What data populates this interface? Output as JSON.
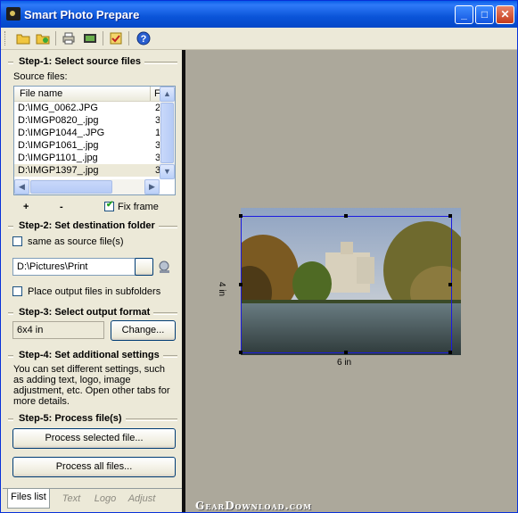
{
  "window": {
    "title": "Smart Photo Prepare",
    "minimize": "_",
    "maximize": "□",
    "close": "✕"
  },
  "toolbar": {
    "icons": [
      "open-folder-icon",
      "open-project-icon",
      "print-icon",
      "film-icon",
      "checklist-icon",
      "help-icon"
    ]
  },
  "steps": {
    "step1": "Step-1: Select source files",
    "source_label": "Source files:",
    "step2": "Step-2: Set destination folder",
    "step3": "Step-3: Select output format",
    "step4": "Step-4: Set additional settings",
    "step4_desc": "You can set different settings, such as adding text, logo, image adjustment, etc. Open other tabs for more details.",
    "step5": "Step-5: Process file(s)"
  },
  "filelist": {
    "headers": [
      "File name",
      "F"
    ],
    "rows": [
      {
        "name": "D:\\IMG_0062.JPG",
        "f": "2"
      },
      {
        "name": "D:\\IMGP0820_.jpg",
        "f": "3"
      },
      {
        "name": "D:\\IMGP1044_.JPG",
        "f": "1"
      },
      {
        "name": "D:\\IMGP1061_.jpg",
        "f": "3"
      },
      {
        "name": "D:\\IMGP1101_.jpg",
        "f": "3"
      },
      {
        "name": "D:\\IMGP1397_.jpg",
        "f": "3"
      }
    ],
    "add": "+",
    "remove": "-",
    "fix_frame_label": "Fix frame",
    "fix_frame_checked": true
  },
  "destination": {
    "same_as_source_label": "same as source file(s)",
    "same_as_source_checked": false,
    "path": "D:\\Pictures\\Print",
    "subfolders_label": "Place output files in subfolders",
    "subfolders_checked": false
  },
  "format": {
    "value": "6x4 in",
    "change_label": "Change..."
  },
  "process": {
    "selected_label": "Process selected file...",
    "all_label": "Process all files..."
  },
  "tabs": [
    "Files list",
    "Text",
    "Logo",
    "Adjust"
  ],
  "active_tab": "Files list",
  "preview": {
    "width_label": "6 in",
    "height_label": "4 in"
  },
  "watermark": "GearDownload.com",
  "colors": {
    "titlebar": "#0a54d8",
    "preview_bg": "#aca89b",
    "frame": "#1a1ae0"
  }
}
